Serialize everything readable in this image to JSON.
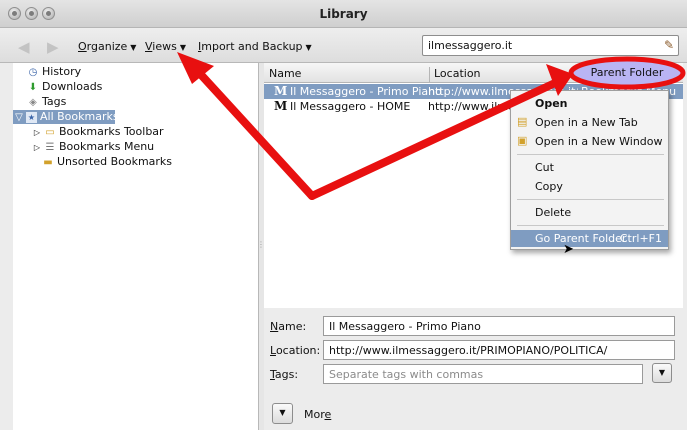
{
  "window": {
    "title": "Library"
  },
  "toolbar": {
    "back_label": "◀",
    "forward_label": "▶",
    "organize": {
      "prefix": "",
      "key": "O",
      "rest": "rganize"
    },
    "views": {
      "prefix": "",
      "key": "V",
      "rest": "iews"
    },
    "import": {
      "prefix": "",
      "key": "I",
      "rest": "mport and Backup"
    },
    "search_value": "ilmessaggero.it",
    "caret": "▼"
  },
  "sidebar": {
    "items": [
      {
        "label": "History",
        "icon": "clock-icon"
      },
      {
        "label": "Downloads",
        "icon": "download-icon"
      },
      {
        "label": "Tags",
        "icon": "tag-icon"
      },
      {
        "label": "All Bookmarks",
        "icon": "bookmarks-icon",
        "selected": true
      },
      {
        "label": "Bookmarks Toolbar",
        "icon": "toolbar-folder-icon"
      },
      {
        "label": "Bookmarks Menu",
        "icon": "menu-folder-icon"
      },
      {
        "label": "Unsorted Bookmarks",
        "icon": "folder-icon"
      }
    ]
  },
  "columns": {
    "name": "Name",
    "location": "Location",
    "parent_folder": "Parent Folder"
  },
  "rows": [
    {
      "name": "Il Messaggero - Primo Piano",
      "location": "http://www.ilmessaggero.it/PRIMOPIANO/POLITICA/",
      "parent": "Bookmarks Menu",
      "selected": true
    },
    {
      "name": "Il Messaggero - HOME",
      "location": "http://www.ilmessaggero.it/",
      "parent": "",
      "selected": false
    }
  ],
  "favicon_glyph": "M",
  "details": {
    "name_label": {
      "key": "N",
      "rest": "ame:"
    },
    "name_value": "Il Messaggero - Primo Piano",
    "location_label": {
      "key": "L",
      "rest": "ocation:"
    },
    "location_value": "http://www.ilmessaggero.it/PRIMOPIANO/POLITICA/",
    "tags_label": {
      "key": "T",
      "rest": "ags:"
    },
    "tags_placeholder": "Separate tags with commas",
    "more_label": {
      "prefix": "Mor",
      "key": "e"
    }
  },
  "context_menu": {
    "items": [
      {
        "label": "Open",
        "bold": true,
        "icon": ""
      },
      {
        "label": "Open in a New Tab",
        "icon": "folder-tab-icon"
      },
      {
        "label": "Open in a New Window",
        "icon": "window-icon"
      },
      {
        "label": "Cut"
      },
      {
        "label": "Copy"
      },
      {
        "label": "Delete"
      },
      {
        "label": "Go Parent Folder",
        "shortcut": "Ctrl+F1",
        "highlighted": true
      }
    ]
  },
  "colors": {
    "selection": "#7f9cc1",
    "annotation_red": "#e81010",
    "highlight_purple": "#b9b4f3"
  }
}
